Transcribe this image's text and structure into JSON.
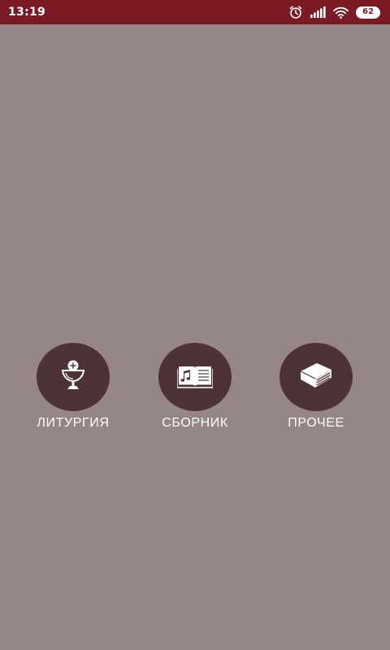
{
  "status_bar": {
    "time": "13:19",
    "battery": "62",
    "background": "#7a1a25",
    "icons": [
      "alarm-icon",
      "signal-icon",
      "wifi-icon",
      "battery-icon"
    ]
  },
  "main": {
    "background": "#968685",
    "button_color": "#4e3336",
    "menu": [
      {
        "label": "ЛИТУРГИЯ",
        "icon": "chalice-icon"
      },
      {
        "label": "СБОРНИК",
        "icon": "music-book-icon"
      },
      {
        "label": "ПРОЧЕЕ",
        "icon": "book-icon"
      }
    ]
  }
}
